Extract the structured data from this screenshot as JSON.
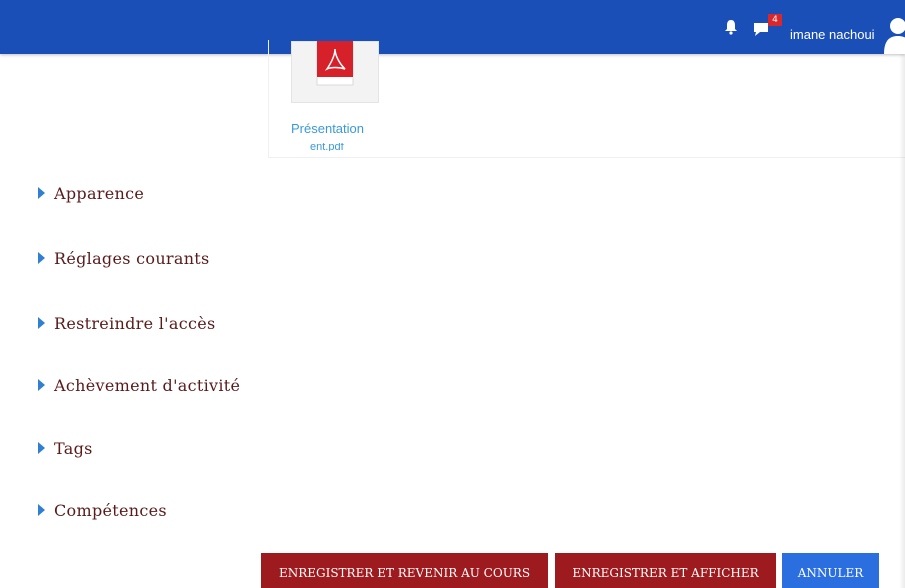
{
  "header": {
    "user_name": "imane nachoui",
    "notification_count": "4",
    "icons": [
      "bell-icon",
      "chat-icon",
      "avatar-icon"
    ]
  },
  "resource": {
    "file_name": "Présentation",
    "file_name_cut": "ent.pdf",
    "icon": "pdf-icon"
  },
  "sections": [
    {
      "label": "Apparence"
    },
    {
      "label": "Réglages courants"
    },
    {
      "label": "Restreindre l'accès"
    },
    {
      "label": "Achèvement d'activité"
    },
    {
      "label": "Tags"
    },
    {
      "label": "Compétences"
    }
  ],
  "buttons": {
    "save_return": "ENREGISTRER ET REVENIR AU COURS",
    "save_show": "ENREGISTRER ET AFFICHER",
    "cancel": "ANNULER"
  },
  "colors": {
    "navbar": "#1a4fb8",
    "primary_button": "#9d1a1f",
    "cancel_button": "#2a6ee0",
    "section_text": "#5a1a1a",
    "caret": "#2f7fd2",
    "link": "#3a9ad9"
  }
}
